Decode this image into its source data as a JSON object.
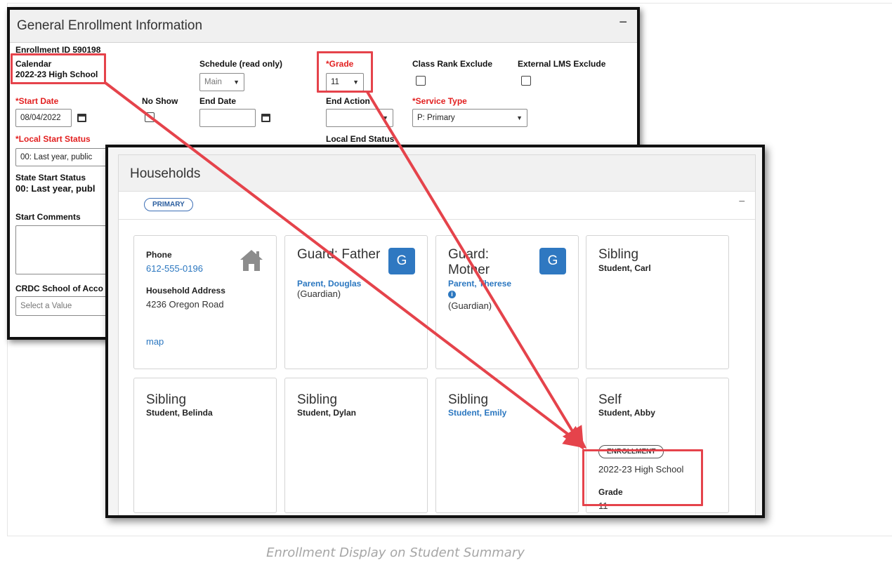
{
  "enrollment": {
    "title": "General Enrollment Information",
    "collapse_glyph": "−",
    "enrollment_id_text": "Enrollment ID 590198",
    "calendar_label": "Calendar",
    "calendar_value": "2022-23 High School",
    "schedule_label": "Schedule (read only)",
    "schedule_value": "Main",
    "grade_label": "*Grade",
    "grade_value": "11",
    "class_rank_label": "Class Rank Exclude",
    "external_lms_label": "External LMS Exclude",
    "start_date_label": "*Start Date",
    "start_date_value": "08/04/2022",
    "no_show_label": "No Show",
    "end_date_label": "End Date",
    "end_date_value": "",
    "end_action_label": "End Action",
    "end_action_value": "",
    "service_type_label": "*Service Type",
    "service_type_value": "P: Primary",
    "local_start_status_label": "*Local Start Status",
    "local_start_status_value": "00: Last year, public",
    "local_end_status_label": "Local End Status",
    "state_start_status_label": "State Start Status",
    "state_start_status_value": "00: Last year, publ",
    "start_comments_label": "Start Comments",
    "crdc_label": "CRDC School of Acco",
    "crdc_placeholder": "Select a Value"
  },
  "households": {
    "title": "Households",
    "primary_badge": "PRIMARY",
    "collapse_glyph": "−",
    "address_card": {
      "phone_label": "Phone",
      "phone_value": "612-555-0196",
      "address_label": "Household Address",
      "address_value": "4236 Oregon Road",
      "map_link": "map",
      "icon": "house-icon"
    },
    "members": [
      {
        "relationship": "Guard: Father",
        "name": "Parent, Douglas",
        "note": "(Guardian)",
        "guardian_badge": "G"
      },
      {
        "relationship": "Guard: Mother",
        "name": "Parent, Therese",
        "note": "(Guardian)",
        "guardian_badge": "G"
      },
      {
        "relationship": "Sibling",
        "name": "Student, Carl"
      },
      {
        "relationship": "Sibling",
        "name": "Student, Belinda"
      },
      {
        "relationship": "Sibling",
        "name": "Student, Dylan"
      },
      {
        "relationship": "Sibling",
        "name": "Student, Emily"
      },
      {
        "relationship": "Self",
        "name": "Student, Abby",
        "enrollment_badge": "ENROLLMENT",
        "enrollment_calendar": "2022-23 High School",
        "grade_label": "Grade",
        "grade_value": "11"
      }
    ]
  },
  "caption": "Enrollment Display on Student Summary",
  "colors": {
    "highlight": "#e5434b",
    "required_label": "#e21f1f",
    "link": "#2b77c0",
    "guardian_badge": "#2f78c1"
  }
}
